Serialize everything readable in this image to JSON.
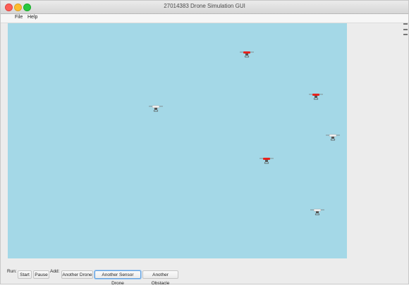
{
  "window": {
    "title": "27014383 Drone Simulation GUI"
  },
  "menubar": {
    "file": "File",
    "help": "Help"
  },
  "toolbar": {
    "run_label": "Run:",
    "start": "Start",
    "pause": "Pause",
    "add_label": "Add:",
    "another_drone": "Another Drone",
    "another_sensor_drone": "Another Sensor Drone",
    "another_obstacle": "Another Obstacle"
  },
  "arena": {
    "background_color": "#a4d8e7",
    "entities": [
      {
        "type": "sensor-drone"
      },
      {
        "type": "sensor-drone"
      },
      {
        "type": "drone"
      },
      {
        "type": "drone"
      },
      {
        "type": "sensor-drone"
      },
      {
        "type": "drone"
      }
    ]
  }
}
